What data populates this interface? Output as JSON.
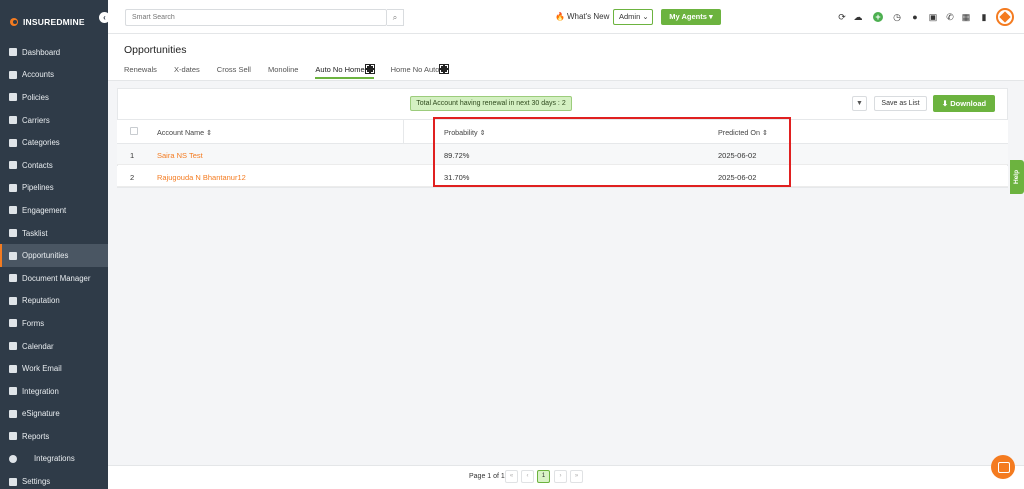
{
  "brand": {
    "name": "INSUREDMINE",
    "accent": "#f47b20",
    "green": "#6cb33f"
  },
  "sidebar": {
    "items": [
      {
        "label": "Dashboard",
        "icon": "dashboard-icon"
      },
      {
        "label": "Accounts",
        "icon": "accounts-icon"
      },
      {
        "label": "Policies",
        "icon": "policies-icon"
      },
      {
        "label": "Carriers",
        "icon": "carriers-icon"
      },
      {
        "label": "Categories",
        "icon": "categories-icon"
      },
      {
        "label": "Contacts",
        "icon": "contacts-icon"
      },
      {
        "label": "Pipelines",
        "icon": "pipelines-icon"
      },
      {
        "label": "Engagement",
        "icon": "megaphone-icon"
      },
      {
        "label": "Tasklist",
        "icon": "tasklist-icon"
      },
      {
        "label": "Opportunities",
        "icon": "bar-chart-icon",
        "active": true
      },
      {
        "label": "Document Manager",
        "icon": "folder-icon"
      },
      {
        "label": "Reputation",
        "icon": "reputation-icon"
      },
      {
        "label": "Forms",
        "icon": "forms-icon"
      },
      {
        "label": "Calendar",
        "icon": "calendar-icon"
      },
      {
        "label": "Work Email",
        "icon": "mail-icon"
      },
      {
        "label": "Integration",
        "icon": "megaphone-icon"
      },
      {
        "label": "eSignature",
        "icon": "signature-icon"
      },
      {
        "label": "Reports",
        "icon": "reports-icon"
      },
      {
        "label": "Integrations",
        "icon": "gears-icon"
      },
      {
        "label": "Settings",
        "icon": "gear-icon"
      }
    ]
  },
  "topbar": {
    "search_placeholder": "Smart Search",
    "whats_new": "What's New",
    "admin_label": "Admin",
    "my_agents_label": "My Agents"
  },
  "page": {
    "title": "Opportunities",
    "tabs": [
      {
        "label": "Renewals"
      },
      {
        "label": "X-dates"
      },
      {
        "label": "Cross Sell"
      },
      {
        "label": "Monoline"
      },
      {
        "label": "Auto No Home",
        "active": true
      },
      {
        "label": "Home No Auto"
      }
    ]
  },
  "toolbar": {
    "banner": "Total Account having renewal in next 30 days : 2",
    "save_as_list": "Save as List",
    "download": "Download"
  },
  "table": {
    "columns": [
      "Account Name",
      "Probability",
      "Predicted On"
    ],
    "rows": [
      {
        "index": "1",
        "account": "Saira NS Test",
        "probability": "89.72%",
        "predicted_on": "2025-06-02"
      },
      {
        "index": "2",
        "account": "Rajugouda N Bhantanur12",
        "probability": "31.70%",
        "predicted_on": "2025-06-02"
      }
    ]
  },
  "pagination": {
    "text": "Page 1 of 1",
    "current": "1"
  },
  "help_label": "Help"
}
